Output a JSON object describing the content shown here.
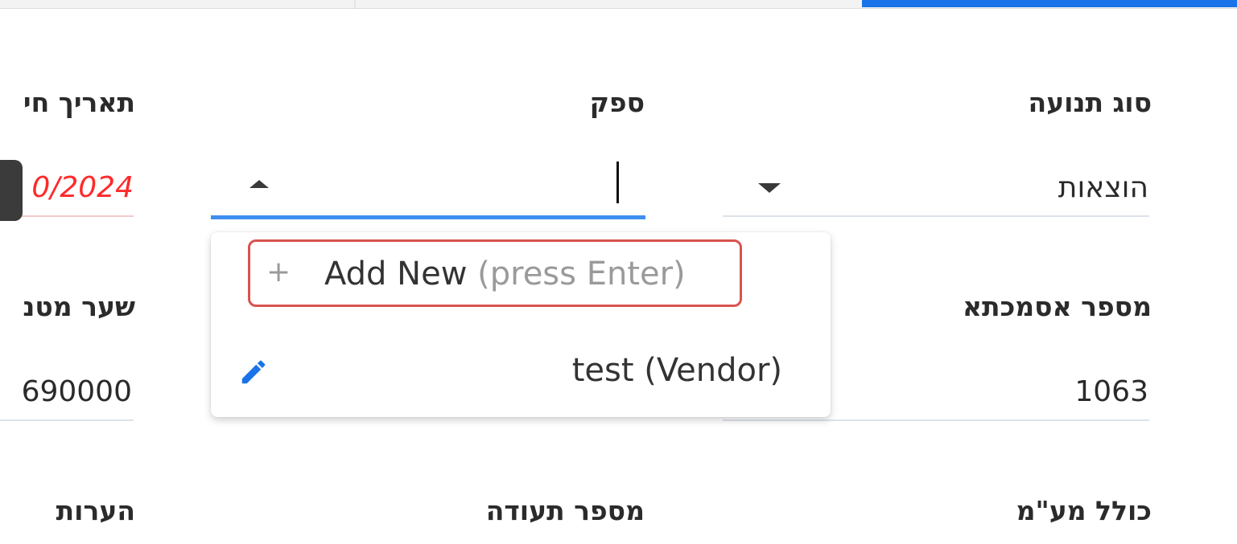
{
  "fields": {
    "transaction_type": {
      "label": "סוג תנועה",
      "value": "הוצאות"
    },
    "vendor": {
      "label": "ספק",
      "value": ""
    },
    "invoice_date": {
      "label": "תאריך חי",
      "value": "0/2024"
    },
    "reference_number": {
      "label": "מספר אסמכתא",
      "value": "1063"
    },
    "exchange_rate": {
      "label": "שער מטנ",
      "value": "690000"
    },
    "includes_vat": {
      "label": "כולל מע\"מ"
    },
    "document_number": {
      "label": "מספר תעודה"
    },
    "notes": {
      "label": "הערות"
    }
  },
  "dropdown": {
    "add_new_label": "Add New",
    "add_new_hint": "(press Enter)",
    "add_icon": "plus-icon",
    "options": [
      {
        "label": "test (Vendor)",
        "icon": "pencil-icon"
      }
    ]
  },
  "colors": {
    "accent": "#1a73e8",
    "focus_underline": "#3f8ff0",
    "highlight_border": "#d9534f",
    "error_text": "#ff2a2a"
  }
}
